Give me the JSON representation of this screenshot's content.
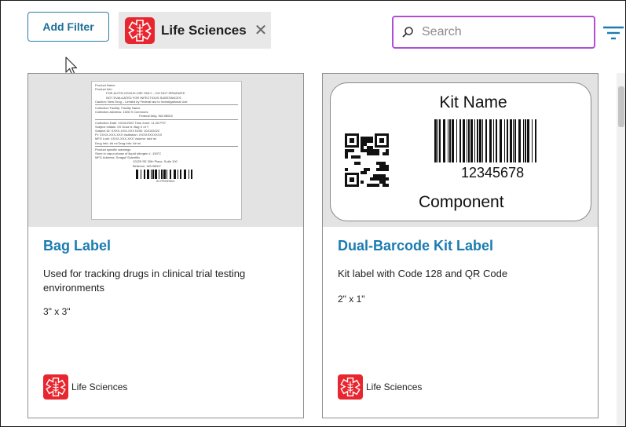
{
  "toolbar": {
    "add_filter_label": "Add Filter",
    "active_filter": {
      "label": "Life Sciences",
      "icon": "life-sciences-icon",
      "close_icon": "close-icon"
    },
    "search": {
      "placeholder": "Search",
      "value": ""
    },
    "filter_menu_icon": "filter-lines-icon"
  },
  "colors": {
    "accent": "#1b7bb1",
    "brand_red": "#e8262f",
    "search_border": "#b14ed6"
  },
  "cards": [
    {
      "title": "Bag Label",
      "description": "Used for tracking drugs in clinical trial testing environments",
      "size": "3\" x 3\"",
      "category": "Life Sciences",
      "thumbnail": {
        "lines": [
          "Product Name",
          "Product Info",
          "FOR AUTOLOGOUS USE ONLY – DO NOT IRRADIATE",
          "NOT EVALUATED FOR INFECTIOUS SUBSTANCES",
          "Caution: New Drug – Limited by Federal law to Investigational Use",
          "Collection Facility:   Facility Name",
          "Collection Address:   1526 S Commons",
          "Federal Way, WA 98003",
          "Collection Date: 10/10/2022        Time Zone: 11:26 PST",
          "Subject Initials: XX               Dose #: Bag X of Y",
          "Subject ID: XXXX-XXX-XXX           DOB: 10/10/2022",
          "PI: XXXX-XXX-XXX                   Institution: XXXXXXXXXXX",
          "MFG Lot#: XXXX-XXX-XXX             Volume: ### ml",
          "Drug Info: ## ml  Drug Info: ## ml",
          "Product specific warnings",
          "Store in vapor phase of liquid nitrogen ≤ -150°C",
          "MFG Address:   Seagull Scientific",
          "10225 SE 30th Place, Suite 100",
          "Bellevue, WA 98007",
          "ID-PROD001"
        ]
      }
    },
    {
      "title": "Dual-Barcode Kit Label",
      "description": "Kit label with Code 128 and QR Code",
      "size": "2\" x 1\"",
      "category": "Life Sciences",
      "thumbnail": {
        "name": "Kit Name",
        "number": "12345678",
        "component": "Component"
      }
    }
  ]
}
